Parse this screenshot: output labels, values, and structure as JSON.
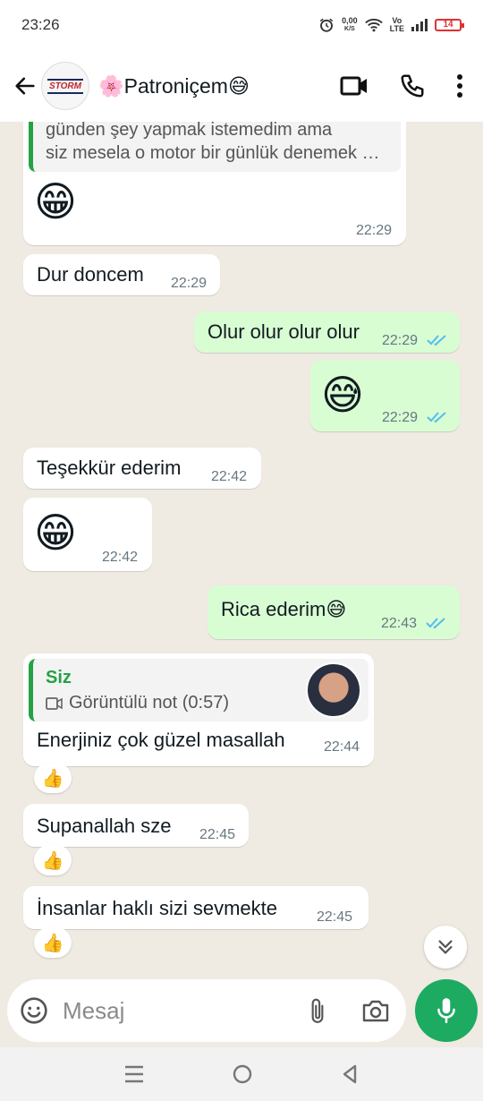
{
  "status_bar": {
    "time": "23:26",
    "net_speed_value": "0,00",
    "net_speed_unit": "K/S",
    "volte_top": "Vo",
    "volte_bottom": "LTE",
    "battery": "14"
  },
  "header": {
    "contact_name": "🌸Patroniçem😅",
    "avatar_logo_text": "STORM"
  },
  "messages": {
    "m1": {
      "quote_line1": "günden şey yapmak istemedim ama",
      "quote_line2": "siz mesela o motor bir günlük denemek …",
      "emoji": "😁",
      "time": "22:29"
    },
    "m2": {
      "text": "Dur doncem",
      "time": "22:29"
    },
    "m3": {
      "text": "Olur olur olur olur",
      "time": "22:29"
    },
    "m4": {
      "emoji": "😅",
      "time": "22:29"
    },
    "m5": {
      "text": "Teşekkür ederim",
      "time": "22:42"
    },
    "m6": {
      "emoji": "😁",
      "time": "22:42"
    },
    "m7": {
      "text": "Rica ederim😅",
      "time": "22:43"
    },
    "m8": {
      "quote_author": "Siz",
      "quote_text": "Görüntülü not  (0:57)",
      "text": "Enerjiniz çok güzel masallah",
      "time": "22:44",
      "reaction": "👍"
    },
    "m9": {
      "text": "Supanallah sze",
      "time": "22:45",
      "reaction": "👍"
    },
    "m10": {
      "text": "İnsanlar haklı sizi sevmekte",
      "time": "22:45",
      "reaction": "👍"
    }
  },
  "input": {
    "placeholder": "Mesaj"
  },
  "colors": {
    "accent_green": "#1daa61",
    "outgoing_bubble": "#d9fdd3",
    "read_ticks": "#53bdeb",
    "quote_bar": "#25a244"
  }
}
